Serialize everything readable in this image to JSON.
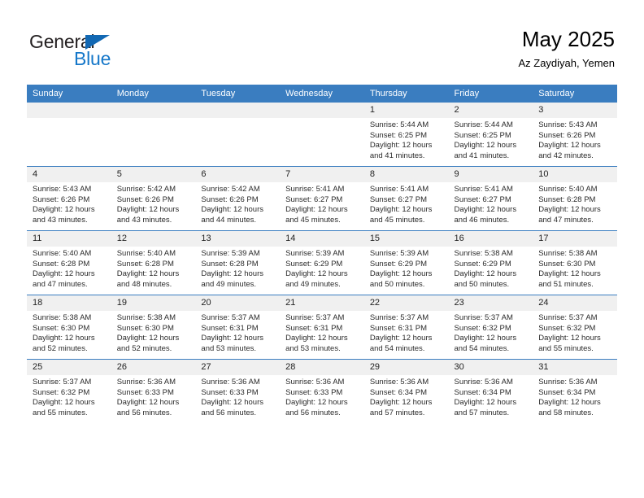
{
  "brand": {
    "name_top": "General",
    "name_bottom": "Blue",
    "color_dark": "#231f20",
    "color_blue": "#1577c9"
  },
  "header": {
    "title": "May 2025",
    "subtitle": "Az Zaydiyah, Yemen"
  },
  "theme": {
    "header_row_bg": "#3a7dc0",
    "daynum_bg": "#f0f0f0",
    "cell_bg": "#ffffff",
    "separator": "#3a7dc0"
  },
  "labels": {
    "sunrise": "Sunrise:",
    "sunset": "Sunset:",
    "daylight": "Daylight:"
  },
  "weekday_headers": [
    "Sunday",
    "Monday",
    "Tuesday",
    "Wednesday",
    "Thursday",
    "Friday",
    "Saturday"
  ],
  "weeks": [
    [
      {
        "day": "",
        "sunrise": "",
        "sunset": "",
        "daylight_line1": "",
        "daylight_line2": ""
      },
      {
        "day": "",
        "sunrise": "",
        "sunset": "",
        "daylight_line1": "",
        "daylight_line2": ""
      },
      {
        "day": "",
        "sunrise": "",
        "sunset": "",
        "daylight_line1": "",
        "daylight_line2": ""
      },
      {
        "day": "",
        "sunrise": "",
        "sunset": "",
        "daylight_line1": "",
        "daylight_line2": ""
      },
      {
        "day": "1",
        "sunrise": "Sunrise: 5:44 AM",
        "sunset": "Sunset: 6:25 PM",
        "daylight_line1": "Daylight: 12 hours",
        "daylight_line2": "and 41 minutes."
      },
      {
        "day": "2",
        "sunrise": "Sunrise: 5:44 AM",
        "sunset": "Sunset: 6:25 PM",
        "daylight_line1": "Daylight: 12 hours",
        "daylight_line2": "and 41 minutes."
      },
      {
        "day": "3",
        "sunrise": "Sunrise: 5:43 AM",
        "sunset": "Sunset: 6:26 PM",
        "daylight_line1": "Daylight: 12 hours",
        "daylight_line2": "and 42 minutes."
      }
    ],
    [
      {
        "day": "4",
        "sunrise": "Sunrise: 5:43 AM",
        "sunset": "Sunset: 6:26 PM",
        "daylight_line1": "Daylight: 12 hours",
        "daylight_line2": "and 43 minutes."
      },
      {
        "day": "5",
        "sunrise": "Sunrise: 5:42 AM",
        "sunset": "Sunset: 6:26 PM",
        "daylight_line1": "Daylight: 12 hours",
        "daylight_line2": "and 43 minutes."
      },
      {
        "day": "6",
        "sunrise": "Sunrise: 5:42 AM",
        "sunset": "Sunset: 6:26 PM",
        "daylight_line1": "Daylight: 12 hours",
        "daylight_line2": "and 44 minutes."
      },
      {
        "day": "7",
        "sunrise": "Sunrise: 5:41 AM",
        "sunset": "Sunset: 6:27 PM",
        "daylight_line1": "Daylight: 12 hours",
        "daylight_line2": "and 45 minutes."
      },
      {
        "day": "8",
        "sunrise": "Sunrise: 5:41 AM",
        "sunset": "Sunset: 6:27 PM",
        "daylight_line1": "Daylight: 12 hours",
        "daylight_line2": "and 45 minutes."
      },
      {
        "day": "9",
        "sunrise": "Sunrise: 5:41 AM",
        "sunset": "Sunset: 6:27 PM",
        "daylight_line1": "Daylight: 12 hours",
        "daylight_line2": "and 46 minutes."
      },
      {
        "day": "10",
        "sunrise": "Sunrise: 5:40 AM",
        "sunset": "Sunset: 6:28 PM",
        "daylight_line1": "Daylight: 12 hours",
        "daylight_line2": "and 47 minutes."
      }
    ],
    [
      {
        "day": "11",
        "sunrise": "Sunrise: 5:40 AM",
        "sunset": "Sunset: 6:28 PM",
        "daylight_line1": "Daylight: 12 hours",
        "daylight_line2": "and 47 minutes."
      },
      {
        "day": "12",
        "sunrise": "Sunrise: 5:40 AM",
        "sunset": "Sunset: 6:28 PM",
        "daylight_line1": "Daylight: 12 hours",
        "daylight_line2": "and 48 minutes."
      },
      {
        "day": "13",
        "sunrise": "Sunrise: 5:39 AM",
        "sunset": "Sunset: 6:28 PM",
        "daylight_line1": "Daylight: 12 hours",
        "daylight_line2": "and 49 minutes."
      },
      {
        "day": "14",
        "sunrise": "Sunrise: 5:39 AM",
        "sunset": "Sunset: 6:29 PM",
        "daylight_line1": "Daylight: 12 hours",
        "daylight_line2": "and 49 minutes."
      },
      {
        "day": "15",
        "sunrise": "Sunrise: 5:39 AM",
        "sunset": "Sunset: 6:29 PM",
        "daylight_line1": "Daylight: 12 hours",
        "daylight_line2": "and 50 minutes."
      },
      {
        "day": "16",
        "sunrise": "Sunrise: 5:38 AM",
        "sunset": "Sunset: 6:29 PM",
        "daylight_line1": "Daylight: 12 hours",
        "daylight_line2": "and 50 minutes."
      },
      {
        "day": "17",
        "sunrise": "Sunrise: 5:38 AM",
        "sunset": "Sunset: 6:30 PM",
        "daylight_line1": "Daylight: 12 hours",
        "daylight_line2": "and 51 minutes."
      }
    ],
    [
      {
        "day": "18",
        "sunrise": "Sunrise: 5:38 AM",
        "sunset": "Sunset: 6:30 PM",
        "daylight_line1": "Daylight: 12 hours",
        "daylight_line2": "and 52 minutes."
      },
      {
        "day": "19",
        "sunrise": "Sunrise: 5:38 AM",
        "sunset": "Sunset: 6:30 PM",
        "daylight_line1": "Daylight: 12 hours",
        "daylight_line2": "and 52 minutes."
      },
      {
        "day": "20",
        "sunrise": "Sunrise: 5:37 AM",
        "sunset": "Sunset: 6:31 PM",
        "daylight_line1": "Daylight: 12 hours",
        "daylight_line2": "and 53 minutes."
      },
      {
        "day": "21",
        "sunrise": "Sunrise: 5:37 AM",
        "sunset": "Sunset: 6:31 PM",
        "daylight_line1": "Daylight: 12 hours",
        "daylight_line2": "and 53 minutes."
      },
      {
        "day": "22",
        "sunrise": "Sunrise: 5:37 AM",
        "sunset": "Sunset: 6:31 PM",
        "daylight_line1": "Daylight: 12 hours",
        "daylight_line2": "and 54 minutes."
      },
      {
        "day": "23",
        "sunrise": "Sunrise: 5:37 AM",
        "sunset": "Sunset: 6:32 PM",
        "daylight_line1": "Daylight: 12 hours",
        "daylight_line2": "and 54 minutes."
      },
      {
        "day": "24",
        "sunrise": "Sunrise: 5:37 AM",
        "sunset": "Sunset: 6:32 PM",
        "daylight_line1": "Daylight: 12 hours",
        "daylight_line2": "and 55 minutes."
      }
    ],
    [
      {
        "day": "25",
        "sunrise": "Sunrise: 5:37 AM",
        "sunset": "Sunset: 6:32 PM",
        "daylight_line1": "Daylight: 12 hours",
        "daylight_line2": "and 55 minutes."
      },
      {
        "day": "26",
        "sunrise": "Sunrise: 5:36 AM",
        "sunset": "Sunset: 6:33 PM",
        "daylight_line1": "Daylight: 12 hours",
        "daylight_line2": "and 56 minutes."
      },
      {
        "day": "27",
        "sunrise": "Sunrise: 5:36 AM",
        "sunset": "Sunset: 6:33 PM",
        "daylight_line1": "Daylight: 12 hours",
        "daylight_line2": "and 56 minutes."
      },
      {
        "day": "28",
        "sunrise": "Sunrise: 5:36 AM",
        "sunset": "Sunset: 6:33 PM",
        "daylight_line1": "Daylight: 12 hours",
        "daylight_line2": "and 56 minutes."
      },
      {
        "day": "29",
        "sunrise": "Sunrise: 5:36 AM",
        "sunset": "Sunset: 6:34 PM",
        "daylight_line1": "Daylight: 12 hours",
        "daylight_line2": "and 57 minutes."
      },
      {
        "day": "30",
        "sunrise": "Sunrise: 5:36 AM",
        "sunset": "Sunset: 6:34 PM",
        "daylight_line1": "Daylight: 12 hours",
        "daylight_line2": "and 57 minutes."
      },
      {
        "day": "31",
        "sunrise": "Sunrise: 5:36 AM",
        "sunset": "Sunset: 6:34 PM",
        "daylight_line1": "Daylight: 12 hours",
        "daylight_line2": "and 58 minutes."
      }
    ]
  ]
}
